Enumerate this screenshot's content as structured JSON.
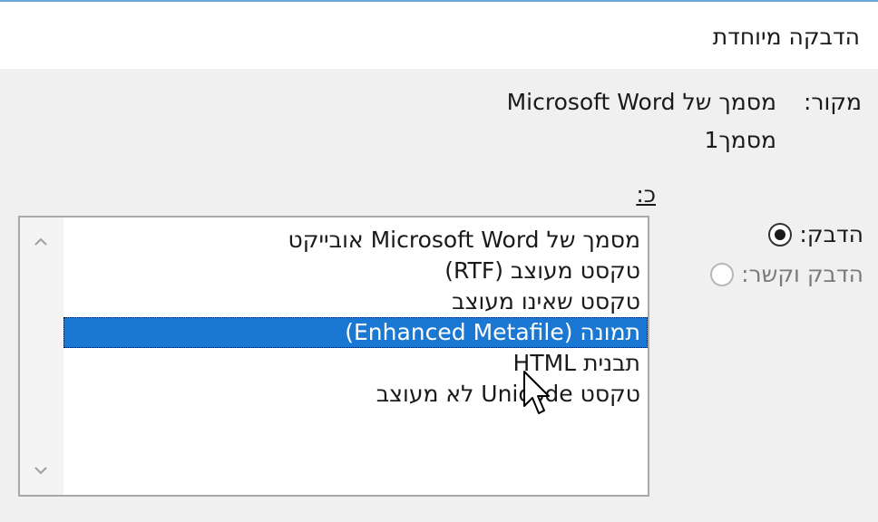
{
  "dialog": {
    "title": "הדבקה מיוחדת"
  },
  "source": {
    "label": "מקור:",
    "line1": "מסמך של Microsoft Word",
    "line2": "מסמך1"
  },
  "as_label": "כ:",
  "radios": {
    "paste_label": "הדבק:",
    "paste_link_label": "הדבק וקשר:"
  },
  "list": {
    "items": [
      "מסמך של Microsoft Word אובייקט",
      "טקסט מעוצב (RTF)",
      "טקסט שאינו מעוצב",
      "תמונה (Enhanced Metafile)",
      "תבנית HTML",
      "טקסט Unicode לא מעוצב"
    ],
    "selected_index": 3
  },
  "colors": {
    "selection": "#1a78d2",
    "title_border": "#6aa8d8"
  }
}
